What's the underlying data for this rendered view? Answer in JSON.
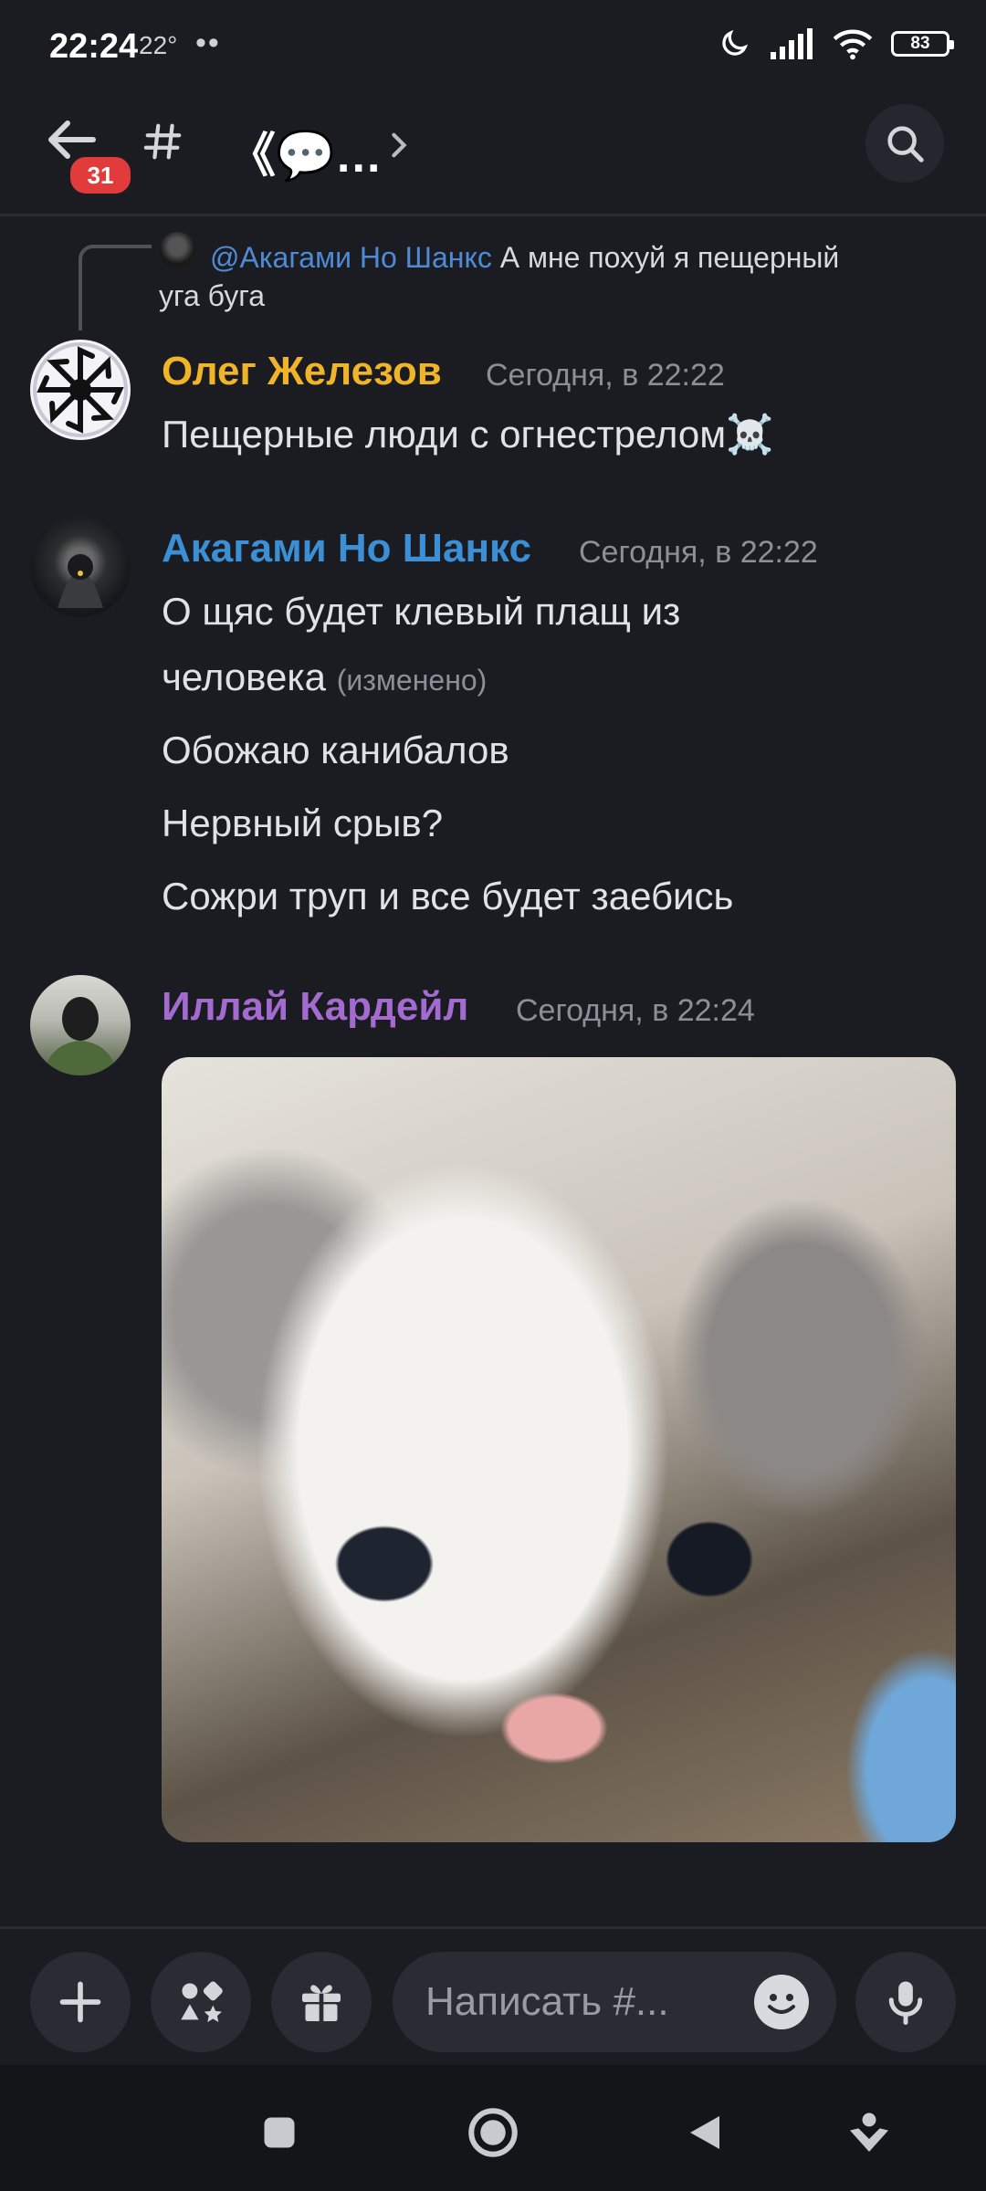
{
  "status_bar": {
    "time": "22:24",
    "temperature": "22°",
    "battery": "83"
  },
  "header": {
    "unread_badge": "31",
    "channel_name": "《💬…"
  },
  "reply": {
    "mention": "@Акагами Но Шанкс",
    "text_line1": "А мне похуй я пещерный",
    "text_line2": "уга буга"
  },
  "messages": [
    {
      "author": "Олег Железов",
      "author_color": "#f0b429",
      "timestamp": "Сегодня, в 22:22",
      "lines": [
        "Пещерные люди с огнестрелом☠️"
      ]
    },
    {
      "author": "Акагами Но Шанкс",
      "author_color": "#3b8fd4",
      "timestamp": "Сегодня, в 22:22",
      "lines": [
        "О щяс будет клевый плащ из",
        "человека",
        "Обожаю канибалов",
        "Нервный срыв?",
        "Сожри труп и все будет заебись"
      ],
      "edited_label": "(изменено)"
    },
    {
      "author": "Иллай Кардейл",
      "author_color": "#a36ad0",
      "timestamp": "Сегодня, в 22:24"
    }
  ],
  "composer": {
    "placeholder": "Написать #..."
  },
  "icons": {
    "back": "back-arrow-icon",
    "channel": "hashtag-icon",
    "chevron": "chevron-right-icon",
    "search": "search-icon",
    "add": "plus-icon",
    "apps": "apps-icon",
    "gift": "gift-icon",
    "emoji": "emoji-icon",
    "mic": "microphone-icon"
  }
}
